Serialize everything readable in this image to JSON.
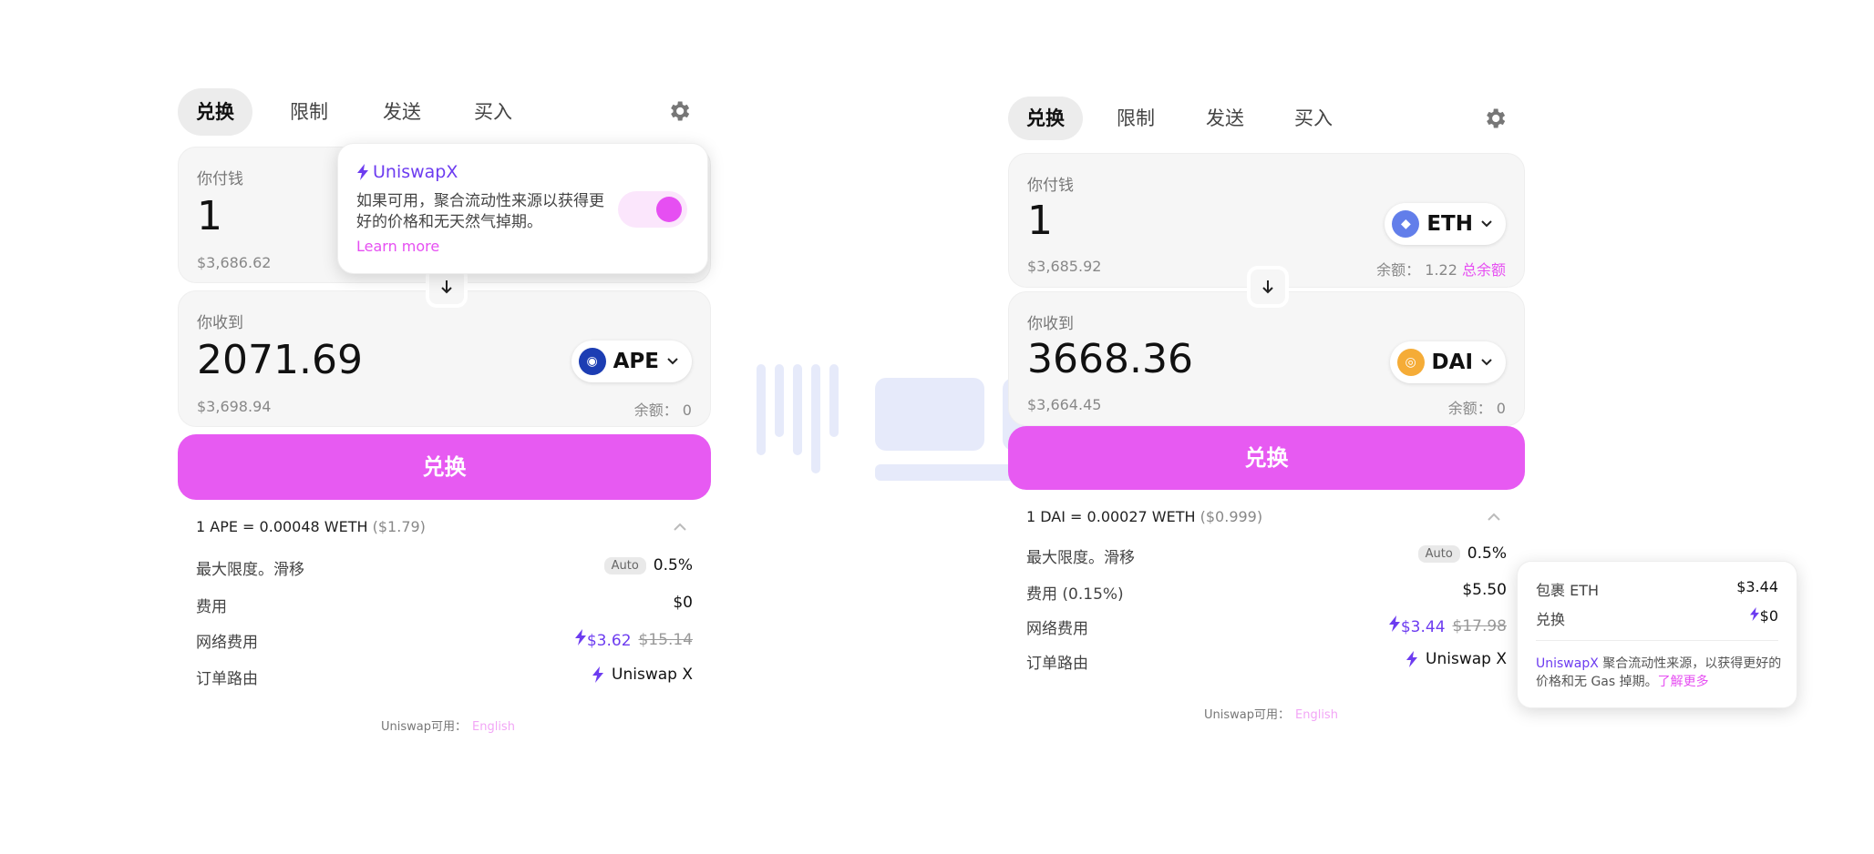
{
  "tabs": [
    "兑换",
    "限制",
    "发送",
    "买入"
  ],
  "colors": {
    "accent": "#e75af2",
    "purple": "#6d3cf0"
  },
  "left": {
    "pay": {
      "label": "你付钱",
      "amount": "1",
      "usd": "$3,686.62"
    },
    "receive": {
      "label": "你收到",
      "amount": "2071.69",
      "usd": "$3,698.94",
      "balance": "余额：  0",
      "token": {
        "name": "APE",
        "icon": "ape-coin-icon",
        "color": "#1c3db3"
      }
    },
    "swap_label": "兑换",
    "rate": "1 APE = 0.00048 WETH",
    "rate_usd": "($1.79)",
    "slippage_label": "最大限度。滑移",
    "slippage_auto": "Auto",
    "slippage_value": "0.5%",
    "fee_label": "费用",
    "fee_value": "$0",
    "network_label": "网络费用",
    "network_value": "$3.62",
    "network_old": "$15.14",
    "route_label": "订单路由",
    "route_value": "Uniswap X",
    "footer": "Uniswap可用：",
    "footer_lang": "English",
    "popup": {
      "title": "UniswapX",
      "text": "如果可用，聚合流动性来源以获得更好的价格和无天然气掉期。",
      "link": "Learn more",
      "enabled": true
    }
  },
  "right": {
    "pay": {
      "label": "你付钱",
      "amount": "1",
      "usd": "$3,685.92",
      "balance": "余额：  1.22",
      "max": "总余额",
      "token": {
        "name": "ETH",
        "icon": "ethereum-icon",
        "color": "#627eea"
      }
    },
    "receive": {
      "label": "你收到",
      "amount": "3668.36",
      "usd": "$3,664.45",
      "balance": "余额：  0",
      "token": {
        "name": "DAI",
        "icon": "dai-icon",
        "color": "#f5ac37"
      }
    },
    "swap_label": "兑换",
    "rate": "1 DAI = 0.00027 WETH",
    "rate_usd": "($0.999)",
    "slippage_label": "最大限度。滑移",
    "slippage_auto": "Auto",
    "slippage_value": "0.5%",
    "fee_label": "费用 (0.15%)",
    "fee_value": "$5.50",
    "network_label": "网络费用",
    "network_value": "$3.44",
    "network_old": "$17.98",
    "route_label": "订单路由",
    "route_value": "Uniswap X",
    "footer": "Uniswap可用：",
    "footer_lang": "English",
    "tooltip": {
      "wrap_label": "包裹 ETH",
      "wrap_value": "$3.44",
      "swap_label": "兑换",
      "swap_value": "$0",
      "brand": "UniswapX",
      "desc": " 聚合流动性来源，以获得更好的价格和无 Gas 掉期。",
      "more": "了解更多"
    }
  }
}
